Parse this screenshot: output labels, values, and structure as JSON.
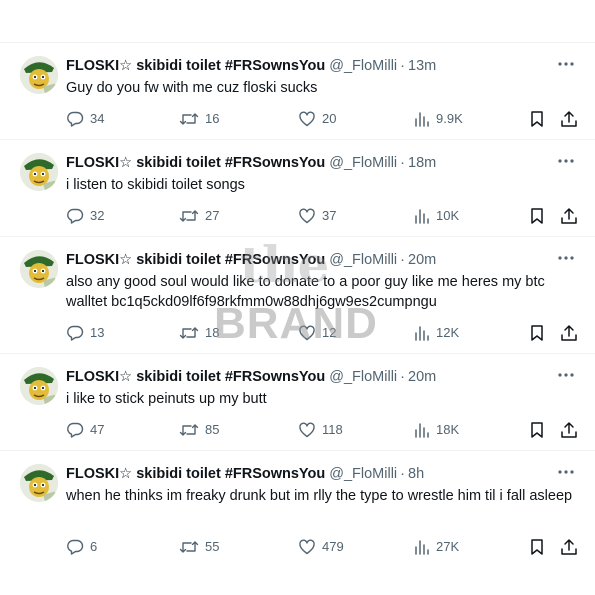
{
  "tweets": [
    {
      "name": "FLOSKI☆ skibidi toilet #FRSownsYou",
      "handle": "@_FloMilli",
      "separator": "·",
      "time": "13m",
      "text": "Guy do you fw with me cuz floski sucks",
      "replies": "34",
      "retweets": "16",
      "likes": "20",
      "views": "9.9K"
    },
    {
      "name": "FLOSKI☆ skibidi toilet #FRSownsYou",
      "handle": "@_FloMilli",
      "separator": "·",
      "time": "18m",
      "text": "i listen to skibidi toilet songs",
      "replies": "32",
      "retweets": "27",
      "likes": "37",
      "views": "10K"
    },
    {
      "name": "FLOSKI☆ skibidi toilet #FRSownsYou",
      "handle": "@_FloMilli",
      "separator": "·",
      "time": "20m",
      "text": "also any good soul would like to donate to a poor guy like me heres my btc walltet bc1q5ckd09lf6f98rkfmm0w88dhj6gw9es2cumpngu",
      "replies": "13",
      "retweets": "18",
      "likes": "12",
      "views": "12K"
    },
    {
      "name": "FLOSKI☆ skibidi toilet #FRSownsYou",
      "handle": "@_FloMilli",
      "separator": "·",
      "time": "20m",
      "text": "i like to stick peinuts up my butt",
      "replies": "47",
      "retweets": "85",
      "likes": "118",
      "views": "18K"
    },
    {
      "name": "FLOSKI☆ skibidi toilet #FRSownsYou",
      "handle": "@_FloMilli",
      "separator": "·",
      "time": "8h",
      "text": "when he thinks im freaky drunk but im rlly the type to wrestle him til i fall asleep",
      "replies": "6",
      "retweets": "55",
      "likes": "479",
      "views": "27K"
    }
  ],
  "watermark": {
    "top": "the",
    "bottom": "BRAND"
  },
  "colors": {
    "text": "#0f1419",
    "secondary": "#536471",
    "divider": "#eff3f4"
  },
  "icons": [
    "reply-icon",
    "retweet-icon",
    "like-icon",
    "views-icon",
    "bookmark-icon",
    "share-icon",
    "more-icon"
  ]
}
